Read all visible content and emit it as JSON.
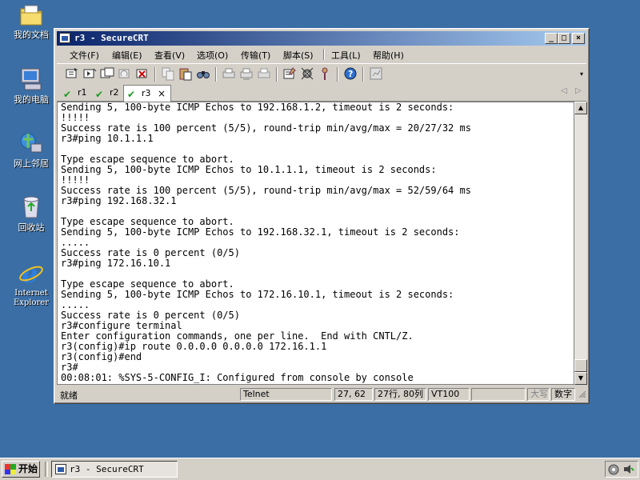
{
  "desktop": {
    "icons": [
      {
        "label": "我的文档"
      },
      {
        "label": "我的电脑"
      },
      {
        "label": "网上邻居"
      },
      {
        "label": "回收站"
      },
      {
        "label": "Internet Explorer"
      }
    ]
  },
  "window": {
    "title": "r3 - SecureCRT",
    "controls": {
      "minimize": "_",
      "maximize": "□",
      "close": "×"
    }
  },
  "menu": {
    "items": [
      "文件(F)",
      "编辑(E)",
      "查看(V)",
      "选项(O)",
      "传输(T)",
      "脚本(S)",
      "工具(L)",
      "帮助(H)"
    ]
  },
  "tabs": [
    {
      "label": "r1"
    },
    {
      "label": "r2"
    },
    {
      "label": "r3",
      "close": "×"
    }
  ],
  "tab_nav": {
    "prev": "◁",
    "next": "▷"
  },
  "terminal": {
    "lines": [
      "Sending 5, 100-byte ICMP Echos to 192.168.1.2, timeout is 2 seconds:",
      "!!!!!",
      "Success rate is 100 percent (5/5), round-trip min/avg/max = 20/27/32 ms",
      "r3#ping 10.1.1.1",
      "",
      "Type escape sequence to abort.",
      "Sending 5, 100-byte ICMP Echos to 10.1.1.1, timeout is 2 seconds:",
      "!!!!!",
      "Success rate is 100 percent (5/5), round-trip min/avg/max = 52/59/64 ms",
      "r3#ping 192.168.32.1",
      "",
      "Type escape sequence to abort.",
      "Sending 5, 100-byte ICMP Echos to 192.168.32.1, timeout is 2 seconds:",
      ".....",
      "Success rate is 0 percent (0/5)",
      "r3#ping 172.16.10.1",
      "",
      "Type escape sequence to abort.",
      "Sending 5, 100-byte ICMP Echos to 172.16.10.1, timeout is 2 seconds:",
      ".....",
      "Success rate is 0 percent (0/5)",
      "r3#configure terminal",
      "Enter configuration commands, one per line.  End with CNTL/Z.",
      "r3(config)#ip route 0.0.0.0 0.0.0.0 172.16.1.1",
      "r3(config)#end",
      "r3#",
      "00:08:01: %SYS-5-CONFIG_I: Configured from console by console"
    ]
  },
  "statusbar": {
    "ready": "就绪",
    "protocol": "Telnet",
    "cursor": "27, 62",
    "size": "27行, 80列",
    "emulation": "VT100",
    "caps": "大写",
    "num": "数字"
  },
  "taskbar": {
    "start": "开始",
    "task": "r3 - SecureCRT"
  },
  "colors": {
    "desktop": "#3a6ea5",
    "title_start": "#0a246a",
    "title_end": "#a6caf0",
    "tab_check": "#1a9a1a"
  }
}
